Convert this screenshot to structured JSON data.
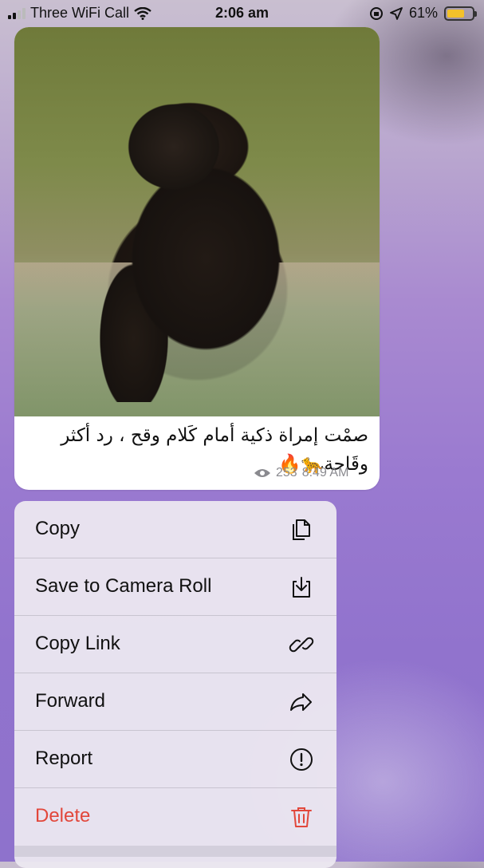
{
  "status_bar": {
    "carrier": "Three WiFi Call",
    "time": "2:06 am",
    "battery": "61%"
  },
  "message": {
    "caption": "صمْت إمراة ذكية أمام كَلام وقح ، رد أكثر وقَاحة🐆🔥",
    "views": "253",
    "time": "8:49 AM"
  },
  "menu": {
    "items": [
      {
        "label": "Copy",
        "icon": "copy-icon"
      },
      {
        "label": "Save to Camera Roll",
        "icon": "download-icon"
      },
      {
        "label": "Copy Link",
        "icon": "link-icon"
      },
      {
        "label": "Forward",
        "icon": "forward-icon"
      },
      {
        "label": "Report",
        "icon": "report-icon"
      },
      {
        "label": "Delete",
        "icon": "trash-icon"
      }
    ]
  },
  "colors": {
    "delete": "#e2473b",
    "battery": "#f3c12a"
  }
}
